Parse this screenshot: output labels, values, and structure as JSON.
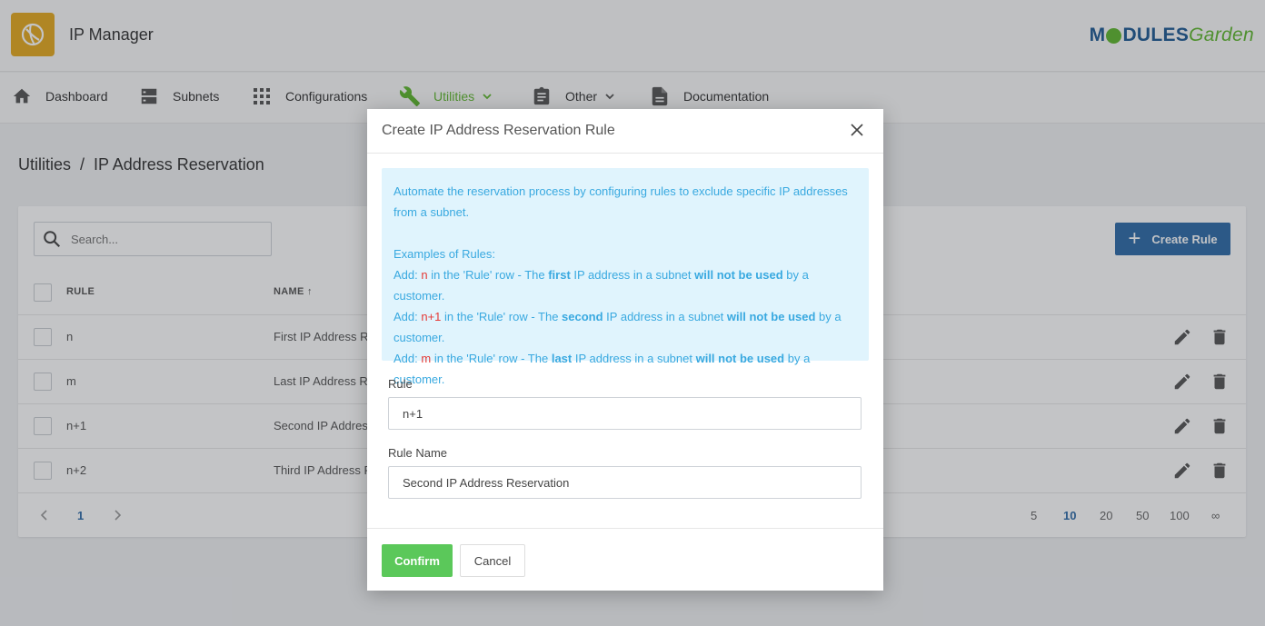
{
  "header": {
    "app_title": "IP Manager",
    "brand_part1": "M",
    "brand_part2": "DULES",
    "brand_part3": "Garden",
    "app_icon": "globe-icon"
  },
  "nav": [
    {
      "label": "Dashboard",
      "icon": "home-icon"
    },
    {
      "label": "Subnets",
      "icon": "server-icon"
    },
    {
      "label": "Configurations",
      "icon": "grid-icon"
    },
    {
      "label": "Utilities",
      "icon": "wrench-icon",
      "active": true
    },
    {
      "label": "Other",
      "icon": "clipboard-icon"
    },
    {
      "label": "Documentation",
      "icon": "document-icon"
    }
  ],
  "breadcrumb": "Utilities  /  IP Address Reservation",
  "search": {
    "placeholder": "Search..."
  },
  "create_button": {
    "label": "Create Rule"
  },
  "table": {
    "headers": {
      "rule": "RULE",
      "name": "NAME"
    },
    "rows": [
      {
        "rule": "n",
        "name": "First IP Address R"
      },
      {
        "rule": "m",
        "name": "Last IP Address R"
      },
      {
        "rule": "n+1",
        "name": "Second IP Addres"
      },
      {
        "rule": "n+2",
        "name": "Third IP Address F"
      }
    ]
  },
  "pagination": {
    "current": "1",
    "sizes": [
      "5",
      "10",
      "20",
      "50",
      "100",
      "∞"
    ],
    "selected_size": "10"
  },
  "modal": {
    "title": "Create IP Address Reservation Rule",
    "info": {
      "intro": "Automate the reservation process by configuring rules to exclude specific IP addresses from a subnet.",
      "examples_title": "Examples of Rules:",
      "examples": [
        {
          "prefix": "Add: ",
          "var": "n",
          "mid": " in the 'Rule' row - The ",
          "ordinal": "first",
          "mid2": " IP address in a subnet ",
          "emph": "will not be used",
          "end": " by a customer."
        },
        {
          "prefix": "Add: ",
          "var": "n+1",
          "mid": " in the 'Rule' row - The ",
          "ordinal": "second",
          "mid2": " IP address in a subnet ",
          "emph": "will not be used",
          "end": " by a customer."
        },
        {
          "prefix": "Add: ",
          "var": "m",
          "mid": " in the 'Rule' row - The ",
          "ordinal": "last",
          "mid2": " IP address in a subnet ",
          "emph": "will not be used",
          "end": " by a customer."
        }
      ]
    },
    "rule_label": "Rule",
    "rule_value": "n+1",
    "rule_name_label": "Rule Name",
    "rule_name_value": "Second IP Address Reservation",
    "confirm": "Confirm",
    "cancel": "Cancel"
  },
  "colors": {
    "accent_green": "#5fb82e",
    "primary_blue": "#2e6ba8",
    "info_text": "#39a9e0",
    "info_bg": "#e0f4fd",
    "rule_var": "#e53935"
  }
}
